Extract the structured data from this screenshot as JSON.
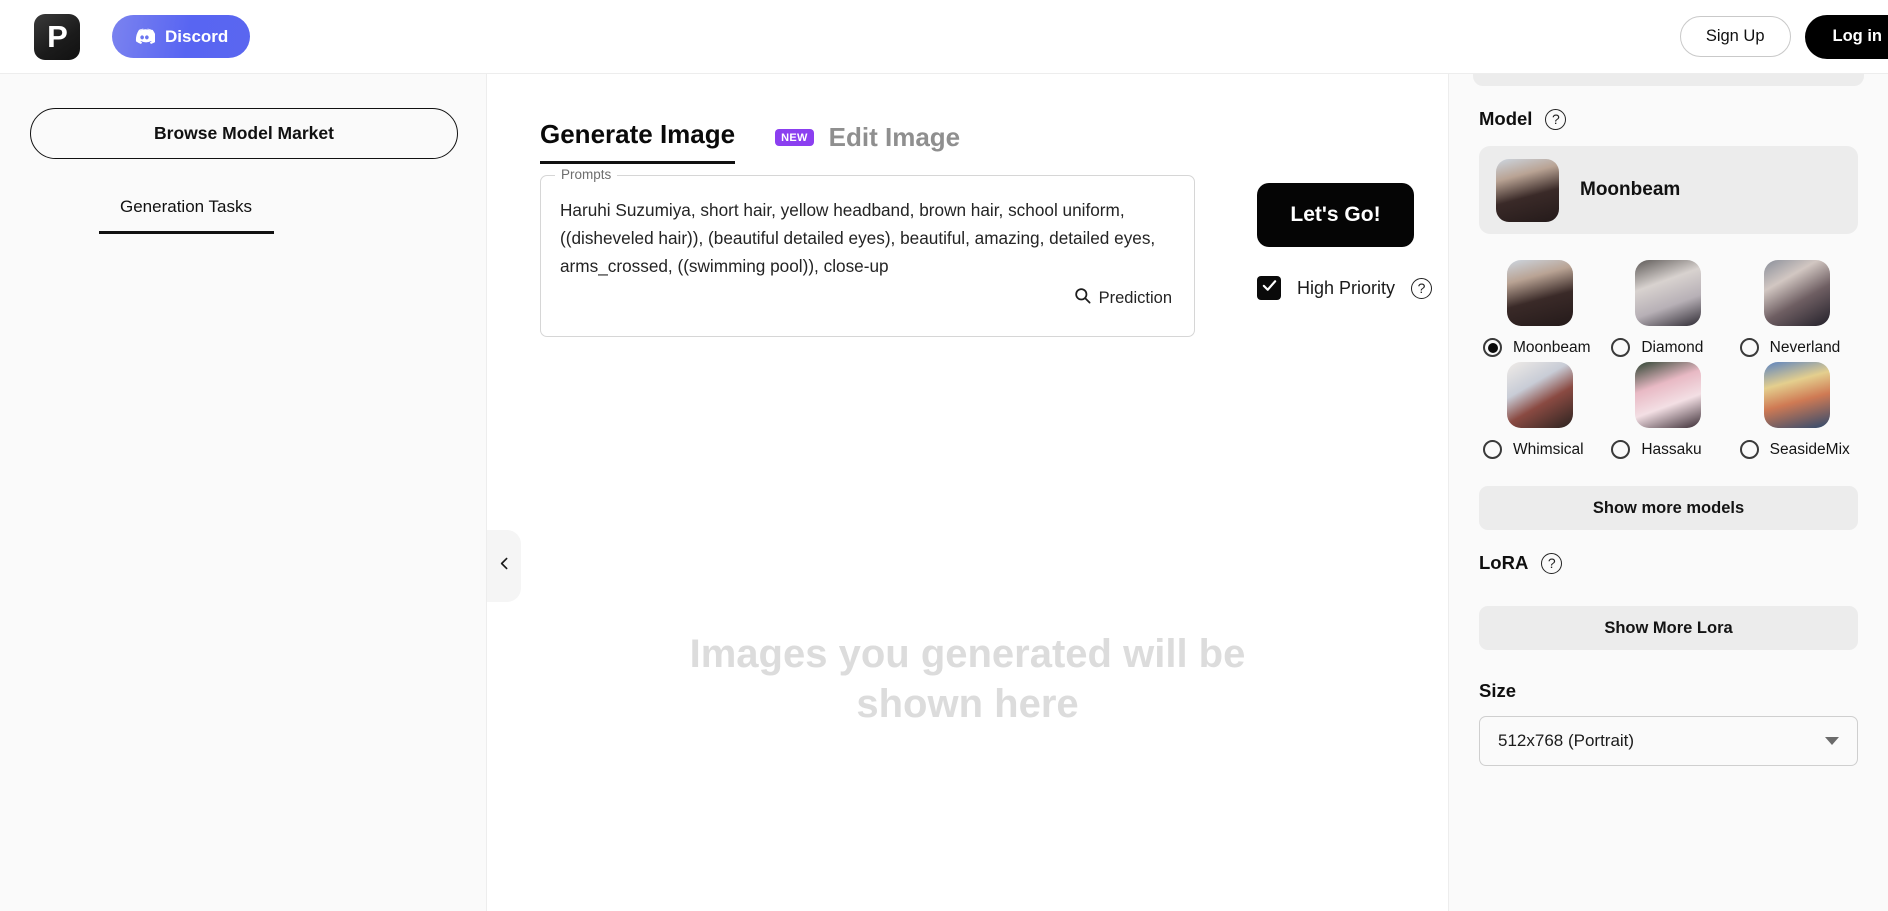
{
  "topbar": {
    "logo_text": "P",
    "discord_label": "Discord",
    "signup_label": "Sign Up",
    "login_label": "Log in"
  },
  "sidebar": {
    "market_button_label": "Browse Model Market",
    "tasks_tab_label": "Generation Tasks"
  },
  "main": {
    "tabs": [
      {
        "label": "Generate Image",
        "active": true
      },
      {
        "label": "Edit Image",
        "active": false,
        "badge": "NEW"
      }
    ],
    "prompts": {
      "legend": "Prompts",
      "value": "Haruhi Suzumiya, short hair, yellow headband, brown hair, school uniform, ((disheveled hair)), (beautiful detailed eyes), beautiful, amazing, detailed eyes, arms_crossed, ((swimming pool)), close-up",
      "prediction_label": "Prediction"
    },
    "generate_button_label": "Let's Go!",
    "high_priority_label": "High Priority",
    "high_priority_checked": true,
    "help_glyph": "?",
    "empty_state_text": "Images you generated will be shown here"
  },
  "rightpanel": {
    "model_section_title": "Model",
    "selected_model": "Moonbeam",
    "models": [
      {
        "name": "Moonbeam",
        "selected": true
      },
      {
        "name": "Diamond",
        "selected": false
      },
      {
        "name": "Neverland",
        "selected": false
      },
      {
        "name": "Whimsical",
        "selected": false
      },
      {
        "name": "Hassaku",
        "selected": false
      },
      {
        "name": "SeasideMix",
        "selected": false
      }
    ],
    "show_more_models_label": "Show more models",
    "lora_section_title": "LoRA",
    "show_more_lora_label": "Show More Lora",
    "size_section_title": "Size",
    "size_value": "512x768 (Portrait)"
  },
  "colors": {
    "discord": "#5865f2",
    "new_badge": "#8b3ff0",
    "accent_dark": "#050505",
    "panel_bg": "#fafafa"
  }
}
